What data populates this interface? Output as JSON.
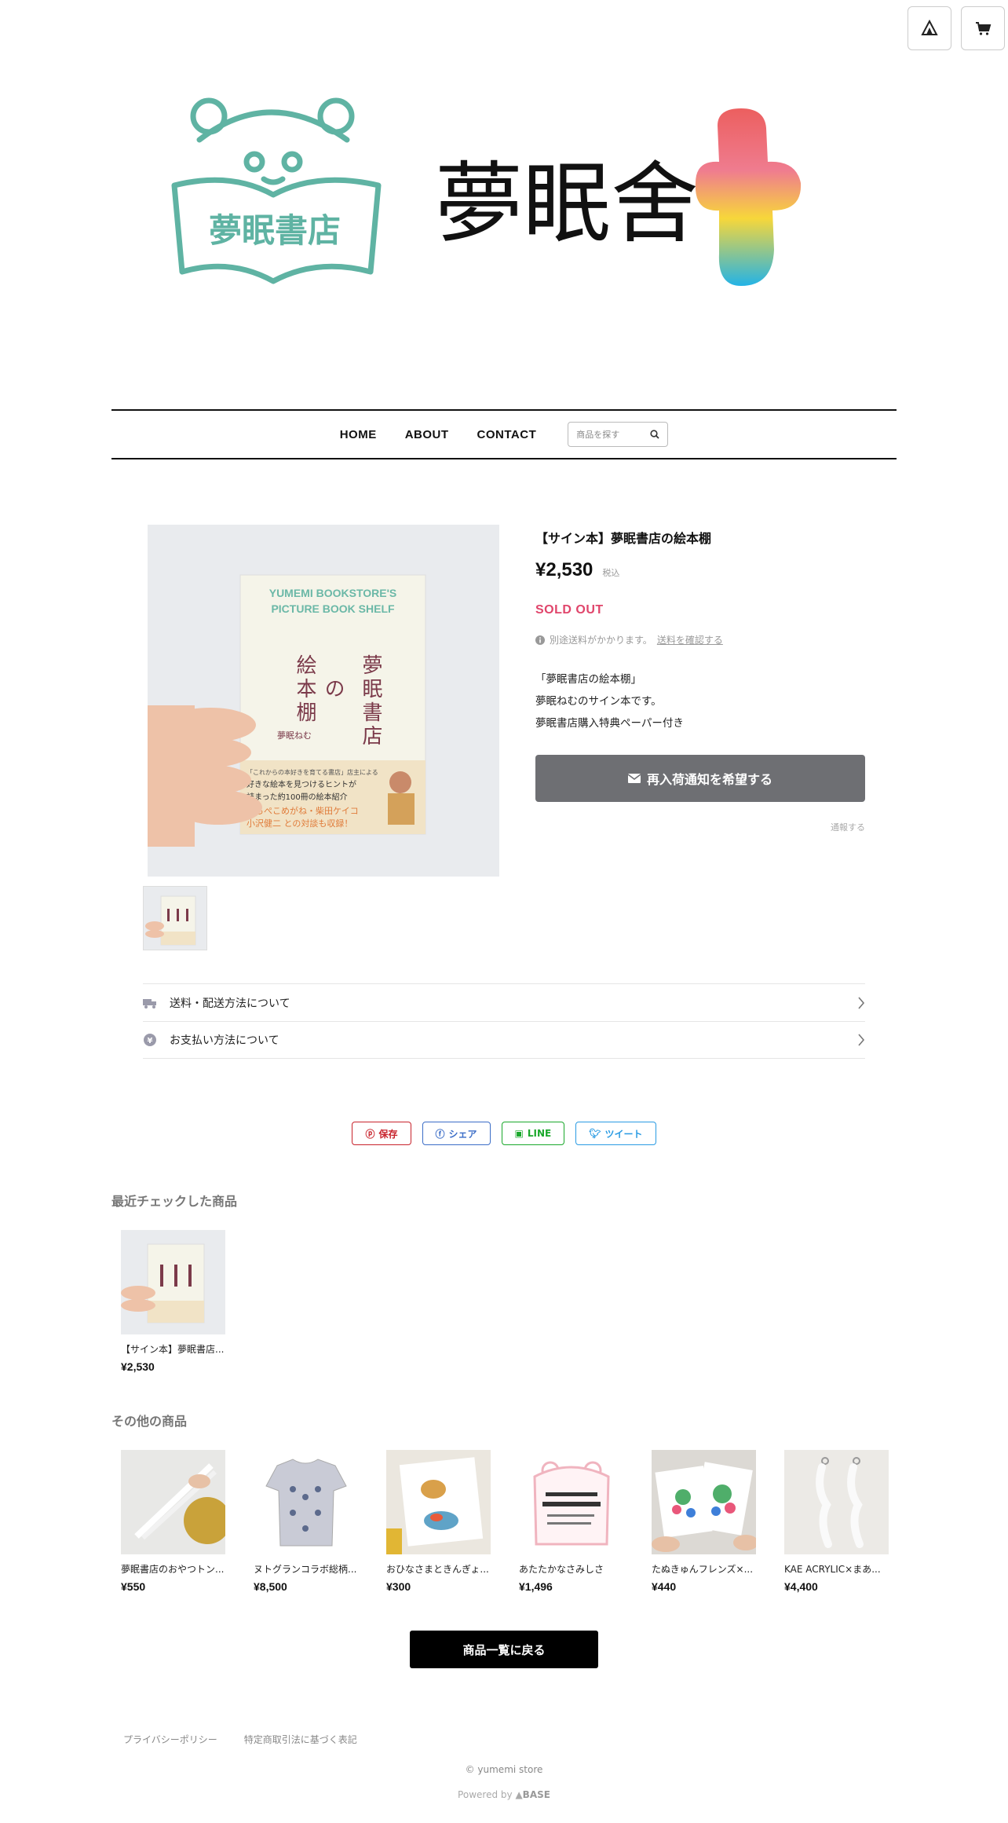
{
  "header": {
    "shop_icon": "tent-icon",
    "cart_icon": "cart-icon",
    "logo": {
      "badge_text": "夢眠書店",
      "wordmark": "夢眠舍",
      "colors": {
        "teal": "#5fb3a3",
        "pink": "#ec6a7d",
        "yellow": "#f7d73a",
        "blue": "#2bb3e3"
      }
    }
  },
  "nav": {
    "items": [
      "HOME",
      "ABOUT",
      "CONTACT"
    ],
    "search_placeholder": "商品を探す"
  },
  "product": {
    "title": "【サイン本】夢眠書店の絵本棚",
    "price": "¥2,530",
    "tax_label": "税込",
    "status": "SOLD OUT",
    "shipping_note": "別途送料がかかります。",
    "shipping_link": "送料を確認する",
    "description": [
      "「夢眠書店の絵本棚」",
      "夢眠ねむのサイン本です。",
      "夢眠書店購入特典ペーパー付き"
    ],
    "notify_button": "再入荷通知を希望する",
    "notify_sub": "通報する",
    "book": {
      "en_title_1": "YUMEMI BOOKSTORE'S",
      "en_title_2": "PICTURE BOOK SHELF",
      "jp_col_right": "夢眠書店",
      "jp_col_mid": "の",
      "jp_col_left": "絵本棚",
      "author": "夢眠ねむ",
      "band_1": "「これからの本好きを育てる書店」店主による",
      "band_2": "好きな絵本を見つけるヒントが",
      "band_3": "詰まった約100冊の絵本紹介",
      "band_4": "ばらぺこめがね・柴田ケイコ",
      "band_5": "小沢健二 との対談も収録！"
    }
  },
  "accordion": [
    {
      "icon": "truck-icon",
      "label": "送料・配送方法について"
    },
    {
      "icon": "yen-icon",
      "label": "お支払い方法について"
    }
  ],
  "share": {
    "pinterest": "保存",
    "facebook": "シェア",
    "line": "LINE",
    "twitter": "ツイート",
    "colors": {
      "pinterest": "#c8232c",
      "facebook": "#3b6dc7",
      "line": "#1aa82b",
      "twitter": "#2a9be3"
    }
  },
  "recent": {
    "title": "最近チェックした商品",
    "items": [
      {
        "name": "【サイン本】夢眠書店...",
        "price": "¥2,530"
      }
    ]
  },
  "others": {
    "title": "その他の商品",
    "items": [
      {
        "name": "夢眠書店のおやつトン...",
        "price": "¥550"
      },
      {
        "name": "ヌトグランコラボ総柄...",
        "price": "¥8,500"
      },
      {
        "name": "おひなさまときんぎょ...",
        "price": "¥300"
      },
      {
        "name": "あたたかなさみしさ",
        "price": "¥1,496"
      },
      {
        "name": "たぬきゅんフレンズ×...",
        "price": "¥440"
      },
      {
        "name": "KAE ACRYLIC×まあ...",
        "price": "¥4,400"
      }
    ]
  },
  "back_button": "商品一覧に戻る",
  "footer": {
    "links": [
      "プライバシーポリシー",
      "特定商取引法に基づく表記"
    ],
    "copyright": "© yumemi store",
    "powered_prefix": "Powered by",
    "powered_brand": "BASE"
  }
}
